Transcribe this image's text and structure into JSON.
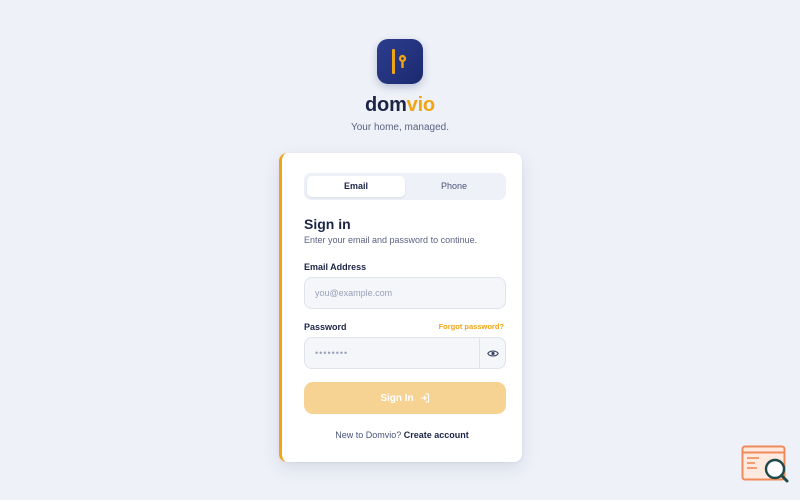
{
  "brand": {
    "name_part1": "dom",
    "name_part2": "vio",
    "tagline": "Your home, managed.",
    "accent_color": "#f0a515",
    "primary_color": "#1d2547",
    "logo_icon": "key-door-icon"
  },
  "tabs": [
    {
      "label": "Email",
      "active": true
    },
    {
      "label": "Phone",
      "active": false
    }
  ],
  "form": {
    "title": "Sign in",
    "subtitle": "Enter your email and password to continue.",
    "email_label": "Email Address",
    "email_placeholder": "you@example.com",
    "email_value": "",
    "password_label": "Password",
    "forgot_link": "Forgot password?",
    "password_value": "••••••••",
    "password_toggle_icon": "eye-icon",
    "submit_label": "Sign In",
    "submit_icon": "login-arrow-icon"
  },
  "footer": {
    "prompt": "New to Domvio? ",
    "create_link": "Create account"
  },
  "widget": {
    "icon": "search-window-icon"
  }
}
